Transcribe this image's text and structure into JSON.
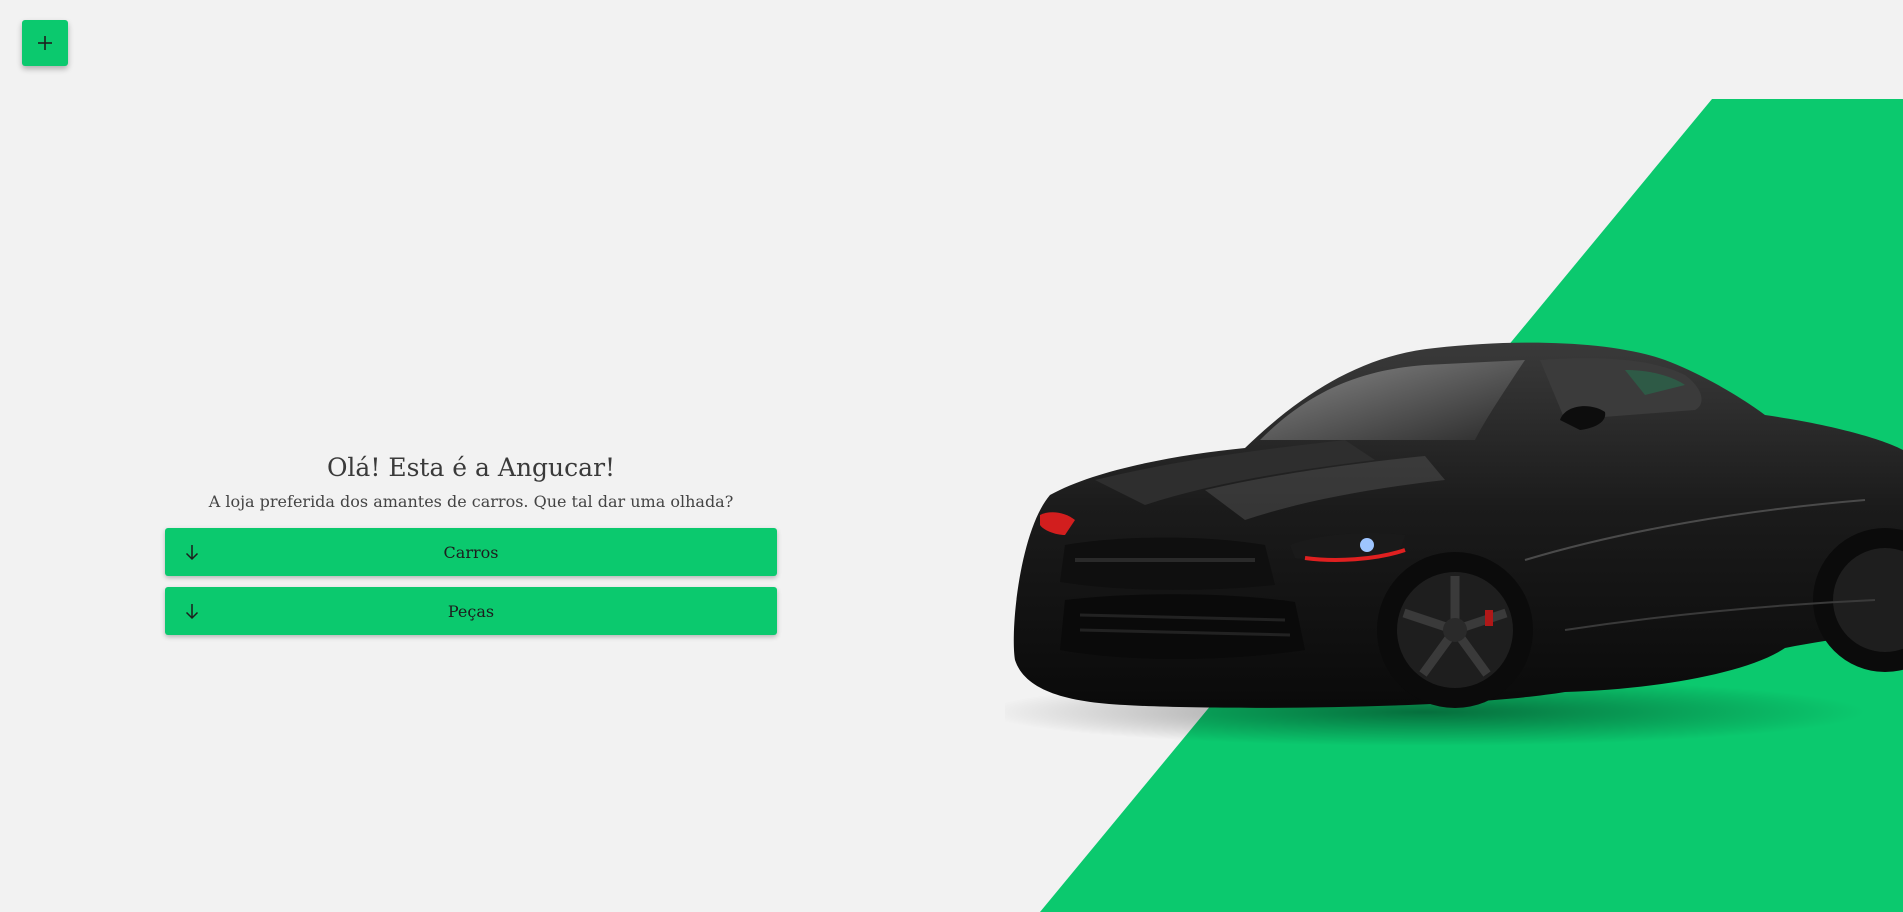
{
  "fab": {
    "icon": "plus-icon"
  },
  "hero": {
    "title": "Olá! Esta é a Angucar!",
    "subtitle": "A loja preferida dos amantes de carros. Que tal dar uma olhada?"
  },
  "buttons": [
    {
      "label": "Carros",
      "icon": "arrow-down-icon"
    },
    {
      "label": "Peças",
      "icon": "arrow-down-icon"
    }
  ],
  "colors": {
    "accent": "#0bc96e",
    "background": "#f2f2f2",
    "car_body": "#141414"
  }
}
